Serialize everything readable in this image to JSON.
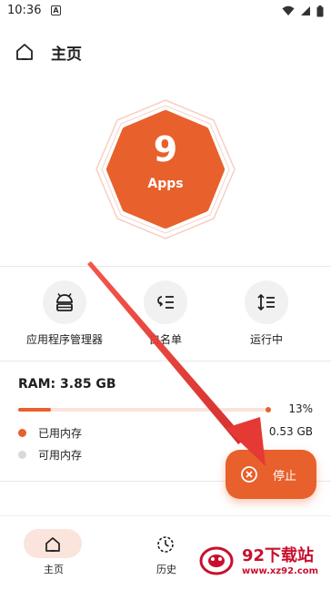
{
  "status_bar": {
    "time": "10:36",
    "notification_letter": "A"
  },
  "header": {
    "title": "主页"
  },
  "badge": {
    "count": "9",
    "label": "Apps"
  },
  "quick_actions": [
    {
      "label": "应用程序管理器",
      "icon": "android-icon"
    },
    {
      "label": "白名单",
      "icon": "whitelist-icon"
    },
    {
      "label": "运行中",
      "icon": "sort-icon"
    }
  ],
  "ram": {
    "title": "RAM: 3.85 GB",
    "used_fraction": 0.13,
    "percent_text": "13%",
    "legend": [
      {
        "label": "已用内存",
        "value": "0.53 GB",
        "color": "#e8602c"
      },
      {
        "label": "可用内存",
        "value": "",
        "color": "#d9d9d9"
      }
    ]
  },
  "stop_button": {
    "label": "停止"
  },
  "bottom_nav": [
    {
      "label": "主页",
      "icon": "home-icon",
      "active": true
    },
    {
      "label": "历史",
      "icon": "history-icon",
      "active": false
    }
  ],
  "watermark": {
    "title": "92下载站",
    "url": "www.xz92.com"
  },
  "colors": {
    "accent": "#e8602c",
    "accent_light": "#fbe4dc",
    "annotation_arrow": "#e53935"
  }
}
